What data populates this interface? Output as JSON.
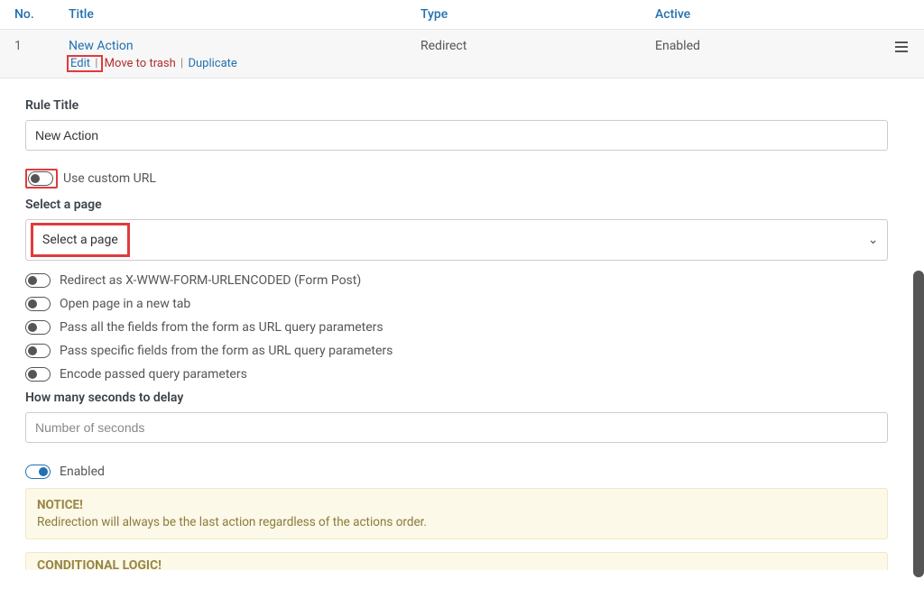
{
  "table": {
    "head": {
      "no": "No.",
      "title": "Title",
      "type": "Type",
      "active": "Active"
    },
    "row": {
      "no": "1",
      "title": "New Action",
      "type": "Redirect",
      "active": "Enabled",
      "actions": {
        "edit": "Edit",
        "trash": "Move to trash",
        "duplicate": "Duplicate"
      }
    }
  },
  "editor": {
    "rule_title_label": "Rule Title",
    "rule_title_value": "New Action",
    "use_custom_url": "Use custom URL",
    "select_page_label": "Select a page",
    "select_page_value": "Select a page",
    "toggles": {
      "form_post": "Redirect as X-WWW-FORM-URLENCODED (Form Post)",
      "new_tab": "Open page in a new tab",
      "pass_all": "Pass all the fields from the form as URL query parameters",
      "pass_specific": "Pass specific fields from the form as URL query parameters",
      "encode": "Encode passed query parameters",
      "enabled": "Enabled"
    },
    "delay_label": "How many seconds to delay",
    "delay_placeholder": "Number of seconds",
    "notice": {
      "heading": "NOTICE!",
      "text": "Redirection will always be the last action regardless of the actions order."
    },
    "conditional_heading": "CONDITIONAL LOGIC!"
  }
}
